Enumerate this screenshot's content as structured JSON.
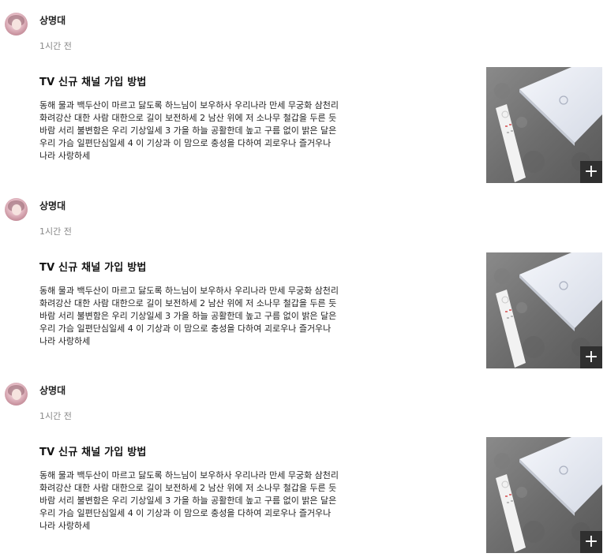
{
  "posts": [
    {
      "author": "상명대",
      "time": "1시간 전",
      "title": "TV 신규 채널 가입 방법",
      "body": "동해 물과 백두산이 마르고 닳도록 하느님이 보우하사 우리나라 만세 무궁화 삼천리 화려강산 대한 사람 대한으로 길이 보전하세 2 남산 위에 저 소나무 철갑을 두른 듯 바람 서리 불변함은 우리 기상일세 3 가을 하늘 공활한데 높고 구름 없이 밝은 달은 우리 가슴 일편단심일세 4 이 기상과 이 맘으로 충성을 다하여 괴로우나 즐거우나 나라 사랑하세",
      "add_icon": "plus-icon"
    },
    {
      "author": "상명대",
      "time": "1시간 전",
      "title": "TV 신규 채널 가입 방법",
      "body": "동해 물과 백두산이 마르고 닳도록 하느님이 보우하사 우리나라 만세 무궁화 삼천리 화려강산 대한 사람 대한으로 길이 보전하세 2 남산 위에 저 소나무 철갑을 두른 듯 바람 서리 불변함은 우리 기상일세 3 가을 하늘 공활한데 높고 구름 없이 밝은 달은 우리 가슴 일편단심일세 4 이 기상과 이 맘으로 충성을 다하여 괴로우나 즐거우나 나라 사랑하세",
      "add_icon": "plus-icon"
    },
    {
      "author": "상명대",
      "time": "1시간 전",
      "title": "TV 신규 채널 가입 방법",
      "body": "동해 물과 백두산이 마르고 닳도록 하느님이 보우하사 우리나라 만세 무궁화 삼천리 화려강산 대한 사람 대한으로 길이 보전하세 2 남산 위에 저 소나무 철갑을 두른 듯 바람 서리 불변함은 우리 기상일세 3 가을 하늘 공활한데 높고 구름 없이 밝은 달은 우리 가슴 일편단심일세 4 이 기상과 이 맘으로 충성을 다하여 괴로우나 즐거우나 나라 사랑하세",
      "add_icon": "plus-icon"
    }
  ],
  "colors": {
    "author_text": "#222222",
    "time_text": "#888888",
    "overlay_button": "#282828"
  }
}
